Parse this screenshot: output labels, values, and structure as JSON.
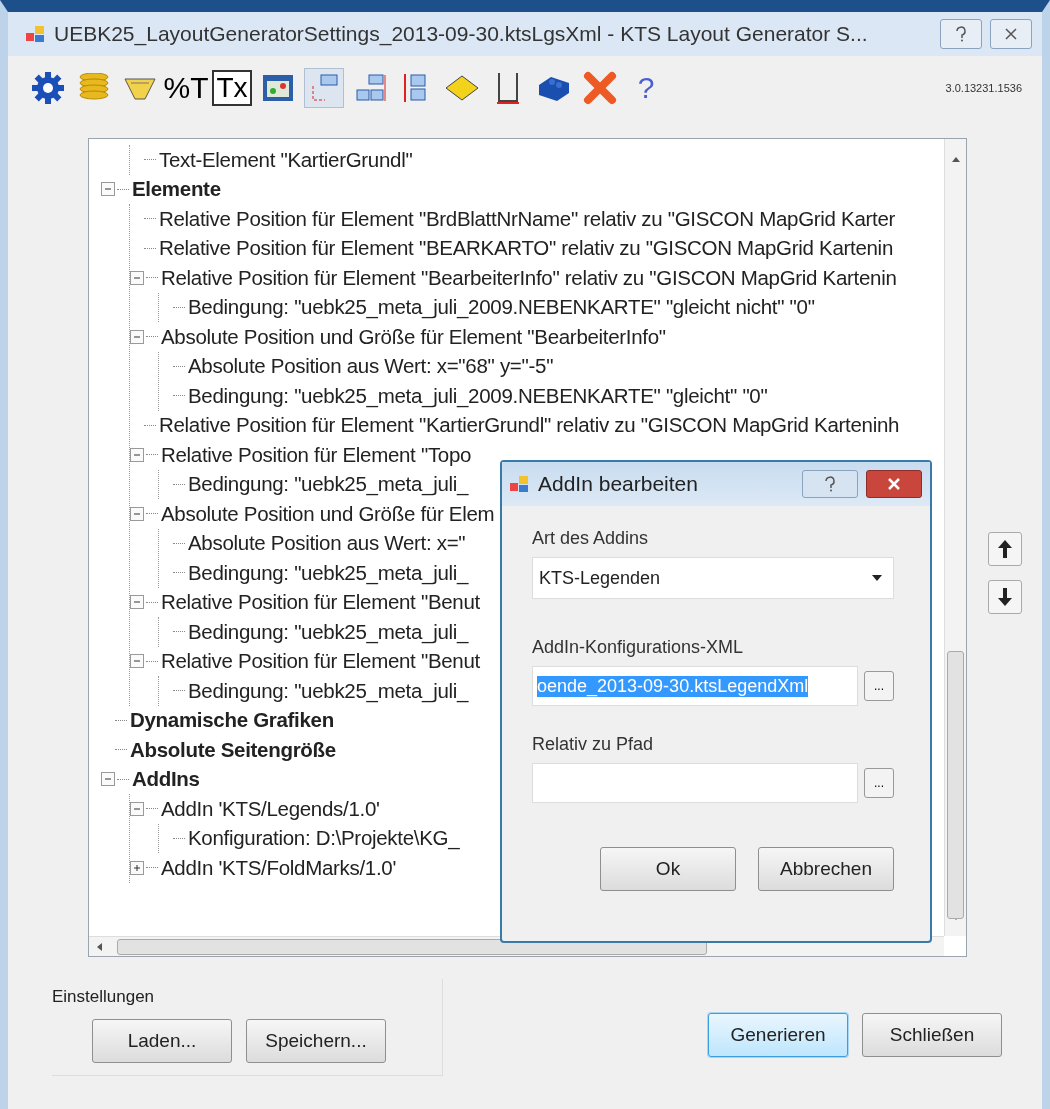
{
  "window": {
    "title": "UEBK25_LayoutGeneratorSettings_2013-09-30.ktsLgsXml - KTS Layout Generator S..."
  },
  "toolbar": {
    "items": [
      {
        "kind": "gear"
      },
      {
        "kind": "stack"
      },
      {
        "kind": "bowl"
      },
      {
        "kind": "text",
        "label": "%T"
      },
      {
        "kind": "boxtext",
        "label": "Tx"
      },
      {
        "kind": "image"
      },
      {
        "kind": "layout",
        "selected": true
      },
      {
        "kind": "layout2"
      },
      {
        "kind": "layout3"
      },
      {
        "kind": "diamond"
      },
      {
        "kind": "page"
      },
      {
        "kind": "brick"
      },
      {
        "kind": "cross"
      },
      {
        "kind": "text",
        "label": "?",
        "color": "#4a5fd0"
      }
    ],
    "version": "3.0.13231.1536"
  },
  "tree": {
    "items": [
      {
        "children": [
          {
            "label": "Text-Element \"KartierGrundl\""
          }
        ]
      },
      {
        "label": "Elemente",
        "expanded": true,
        "children": [
          {
            "label": "Relative Position für Element \"BrdBlattNrName\" relativ zu \"GISCON MapGrid Karter"
          },
          {
            "label": "Relative Position für Element \"BEARKARTO\" relativ zu \"GISCON MapGrid Kartenin"
          },
          {
            "label": "Relative Position für Element \"BearbeiterInfo\" relativ zu \"GISCON MapGrid Kartenin",
            "expanded": true,
            "children": [
              {
                "label": "Bedingung: \"uebk25_meta_juli_2009.NEBENKARTE\" \"gleicht nicht\" \"0\""
              }
            ]
          },
          {
            "label": "Absolute Position und Größe für Element \"BearbeiterInfo\"",
            "expanded": true,
            "children": [
              {
                "label": "Absolute Position aus Wert: x=\"68\" y=\"-5\""
              },
              {
                "label": "Bedingung: \"uebk25_meta_juli_2009.NEBENKARTE\" \"gleicht\" \"0\""
              }
            ]
          },
          {
            "label": "Relative Position für Element \"KartierGrundl\" relativ zu \"GISCON MapGrid Karteninh"
          },
          {
            "label": "Relative Position für Element \"Topo",
            "expanded": true,
            "children": [
              {
                "label": "Bedingung: \"uebk25_meta_juli_"
              }
            ]
          },
          {
            "label": "Absolute Position und Größe für Elem",
            "expanded": true,
            "children": [
              {
                "label": "Absolute Position aus Wert: x=\""
              },
              {
                "label": "Bedingung: \"uebk25_meta_juli_"
              }
            ]
          },
          {
            "label": "Relative Position für Element \"Benut",
            "expanded": true,
            "children": [
              {
                "label": "Bedingung: \"uebk25_meta_juli_"
              }
            ]
          },
          {
            "label": "Relative Position für Element \"Benut",
            "expanded": true,
            "children": [
              {
                "label": "Bedingung: \"uebk25_meta_juli_"
              }
            ]
          }
        ]
      },
      {
        "label": "Dynamische Grafiken"
      },
      {
        "label": "Absolute Seitengröße"
      },
      {
        "label": "AddIns",
        "expanded": true,
        "children": [
          {
            "label": "AddIn 'KTS/Legends/1.0'",
            "expanded": true,
            "children": [
              {
                "label": "Konfiguration: D:\\Projekte\\KG_"
              }
            ]
          },
          {
            "label": "AddIn 'KTS/FoldMarks/1.0'",
            "expanded": false
          }
        ]
      }
    ]
  },
  "settings": {
    "label": "Einstellungen",
    "buttons": [
      "Laden...",
      "Speichern..."
    ]
  },
  "actions": [
    {
      "label": "Generieren",
      "focused": true
    },
    {
      "label": "Schließen",
      "focused": false
    }
  ],
  "dialog": {
    "title": "AddIn bearbeiten",
    "type_label": "Art des Addins",
    "type_value": "KTS-Legenden",
    "xml_label": "AddIn-Konfigurations-XML",
    "xml_value": "oende_2013-09-30.ktsLegendXml",
    "xml_browse": "...",
    "path_label": "Relativ zu Pfad",
    "path_browse": "...",
    "ok": "Ok",
    "cancel": "Abbrechen"
  }
}
